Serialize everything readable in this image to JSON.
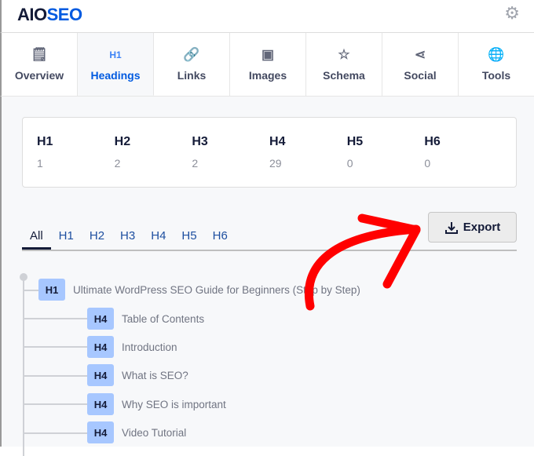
{
  "header": {
    "logo_dark": "AIO",
    "logo_blue": "SEO",
    "settings_icon": "gear-icon"
  },
  "tabs": [
    {
      "label": "Overview",
      "icon": "document-clock-icon",
      "glyph": "🗒"
    },
    {
      "label": "Headings",
      "icon": "h1",
      "glyph": "H1"
    },
    {
      "label": "Links",
      "icon": "link-icon",
      "glyph": "🔗"
    },
    {
      "label": "Images",
      "icon": "image-icon",
      "glyph": "▣"
    },
    {
      "label": "Schema",
      "icon": "star-icon",
      "glyph": "☆"
    },
    {
      "label": "Social",
      "icon": "share-icon",
      "glyph": "⋖"
    },
    {
      "label": "Tools",
      "icon": "globe-icon",
      "glyph": "🌐"
    }
  ],
  "stats": [
    {
      "label": "H1",
      "value": "1"
    },
    {
      "label": "H2",
      "value": "2"
    },
    {
      "label": "H3",
      "value": "2"
    },
    {
      "label": "H4",
      "value": "29"
    },
    {
      "label": "H5",
      "value": "0"
    },
    {
      "label": "H6",
      "value": "0"
    }
  ],
  "filters": [
    "All",
    "H1",
    "H2",
    "H3",
    "H4",
    "H5",
    "H6"
  ],
  "export_label": "Export",
  "headings": [
    {
      "level": "H1",
      "text": "Ultimate WordPress SEO Guide for Beginners (Step by Step)"
    },
    {
      "level": "H4",
      "text": "Table of Contents"
    },
    {
      "level": "H4",
      "text": "Introduction"
    },
    {
      "level": "H4",
      "text": "What is SEO?"
    },
    {
      "level": "H4",
      "text": "Why SEO is important"
    },
    {
      "level": "H4",
      "text": "Video Tutorial"
    }
  ],
  "colors": {
    "brand": "#005ae0",
    "badge": "#a7c7ff",
    "annotation_arrow": "#ff0000"
  }
}
